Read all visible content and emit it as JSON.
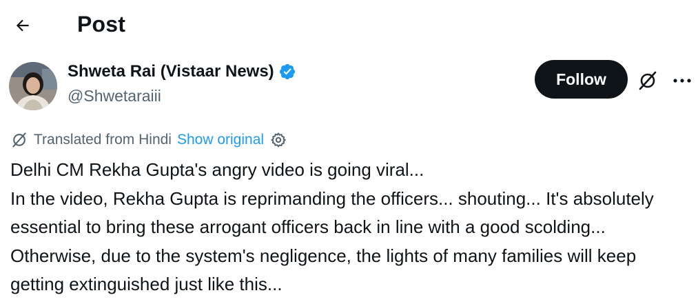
{
  "header": {
    "title": "Post",
    "back_icon": "arrow-left-icon"
  },
  "author": {
    "display_name": "Shweta Rai (Vistaar News)",
    "handle": "@Shwetaraiii",
    "verified_icon": "verified-badge-icon",
    "avatar": "avatar"
  },
  "actions": {
    "follow_label": "Follow",
    "grok_icon": "grok-icon",
    "more_icon": "more-icon"
  },
  "translation": {
    "label": "Translated from Hindi",
    "show_original": "Show original",
    "settings_icon": "gear-icon"
  },
  "post": {
    "text": "Delhi CM Rekha Gupta's angry video is going viral...\nIn the video, Rekha Gupta is reprimanding the officers... shouting... It's absolutely essential to bring these arrogant officers back in line with a good scolding... Otherwise, due to the system's negligence, the lights of many families will keep getting extinguished just like this..."
  },
  "colors": {
    "text_primary": "#0f1419",
    "text_secondary": "#536471",
    "link": "#1d9bf0",
    "verified": "#1d9bf0",
    "follow_bg": "#0f1419"
  }
}
